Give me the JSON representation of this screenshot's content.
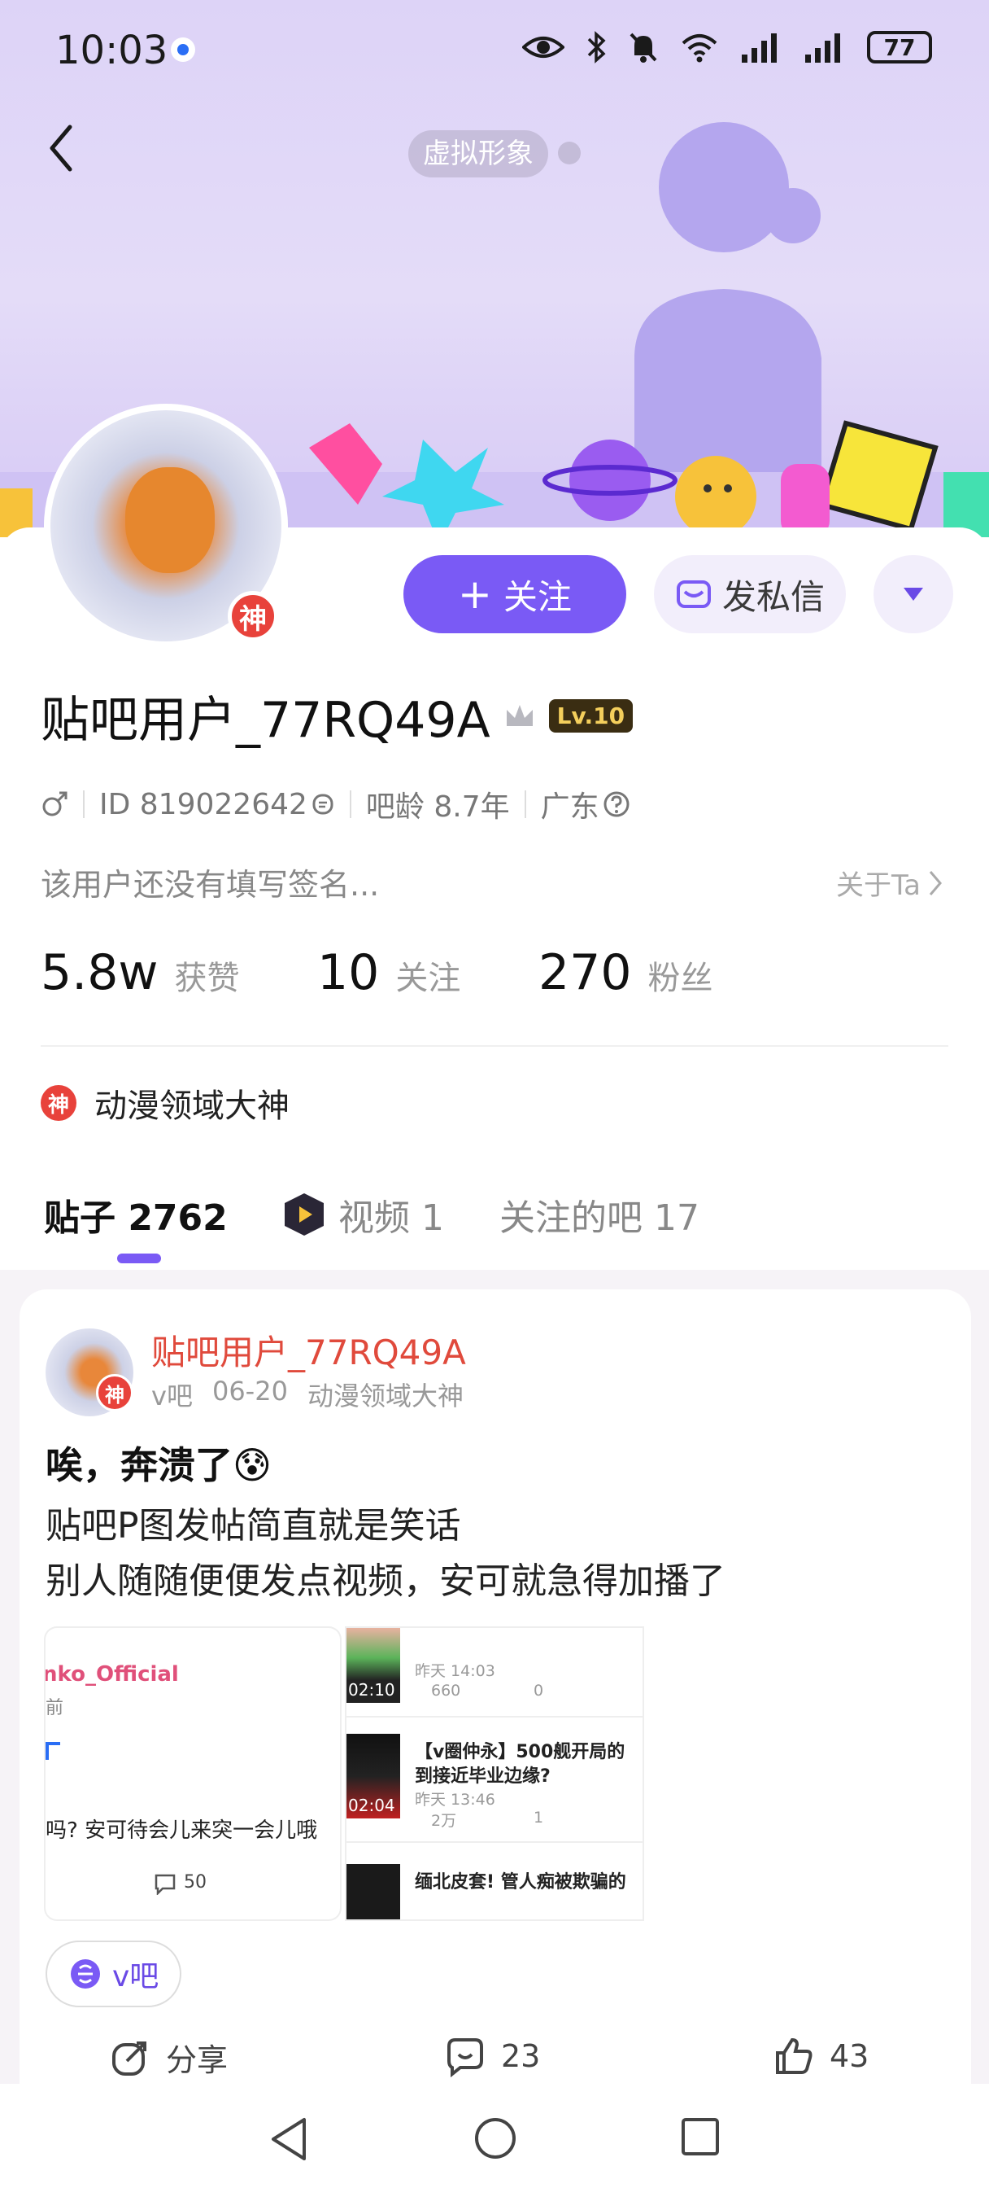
{
  "status_bar": {
    "time": "10:03",
    "battery": "77"
  },
  "header": {
    "virtual_avatar_label": "虚拟形象"
  },
  "profile": {
    "avatar_badge": "神",
    "follow_label": "关注",
    "message_label": "发私信",
    "username": "贴吧用户_77RQ49A",
    "level": "Lv.10",
    "id_text": "ID 819022642",
    "bar_age": "吧龄 8.7年",
    "location": "广东",
    "signature": "该用户还没有填写签名...",
    "about_label": "关于Ta",
    "stats": [
      {
        "value": "5.8w",
        "label": "获赞"
      },
      {
        "value": "10",
        "label": "关注"
      },
      {
        "value": "270",
        "label": "粉丝"
      }
    ],
    "honor_badge": "神",
    "honor_label": "动漫领域大神"
  },
  "tabs": [
    {
      "label": "贴子 2762"
    },
    {
      "label": "视频 1"
    },
    {
      "label": "关注的吧 17"
    }
  ],
  "post": {
    "author": "贴吧用户_77RQ49A",
    "author_badge": "神",
    "forum": "v吧",
    "date": "06-20",
    "honor": "动漫领域大神",
    "title": "唉，奔溃了😰",
    "lines": [
      "贴吧P图发帖简直就是笑话",
      "别人随随便便发点视频，安可就急得加播了"
    ],
    "left_image": {
      "channel": "nko_Official",
      "sub": "前",
      "question": "吗? 安可待会儿来突一会儿哦",
      "comments": "50"
    },
    "right_image": {
      "rows": [
        {
          "duration": "02:10",
          "title": "",
          "time": "昨天 14:03",
          "views": "660",
          "comments": "0"
        },
        {
          "duration": "02:04",
          "title": "【v圈仲永】500舰开局的",
          "title2": "到接近毕业边缘?",
          "time": "昨天 13:46",
          "views": "2万",
          "comments": "1"
        },
        {
          "duration": "",
          "title": "缅北皮套! 管人痴被欺骗的",
          "time": "",
          "views": "",
          "comments": ""
        }
      ]
    },
    "forum_tag": "v吧",
    "share_label": "分享",
    "comment_count": "23",
    "like_count": "43"
  }
}
